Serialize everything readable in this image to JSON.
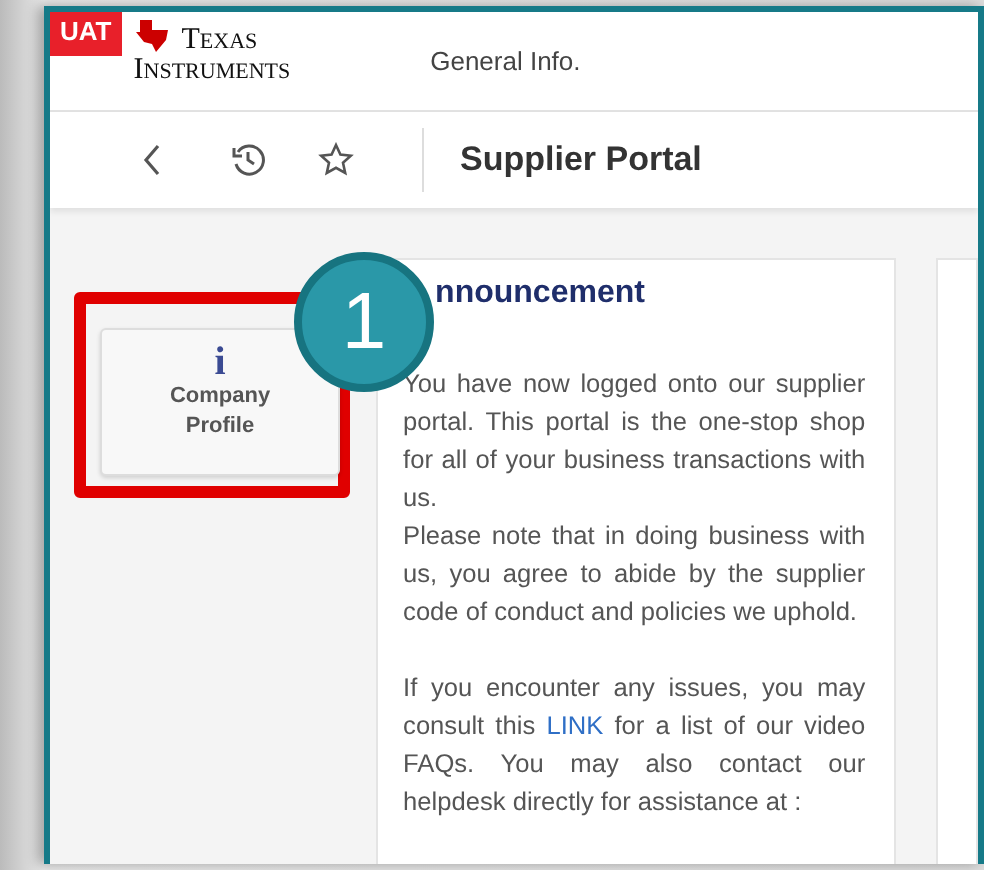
{
  "header": {
    "env_tag": "UAT",
    "logo_top": "Texas",
    "logo_bottom": "Instruments",
    "title": "General Info."
  },
  "nav": {
    "title": "Supplier Portal"
  },
  "tiles": [
    {
      "icon": "i",
      "label": "Company Profile",
      "highlighted": true
    }
  ],
  "callout": {
    "number": "1"
  },
  "announcement": {
    "title": "nnouncement",
    "paragraphs": [
      "You have now logged onto our supplier portal. This portal is the one-stop shop for all of your business transactions with us.",
      "Please note that in doing business with us, you agree to abide by the supplier code of conduct and policies we uphold."
    ],
    "help": {
      "before": "If you encounter any issues, you may consult this",
      "link": "LINK",
      "after": "for a list of our video FAQs. You may also contact our helpdesk directly for assistance at :"
    }
  }
}
